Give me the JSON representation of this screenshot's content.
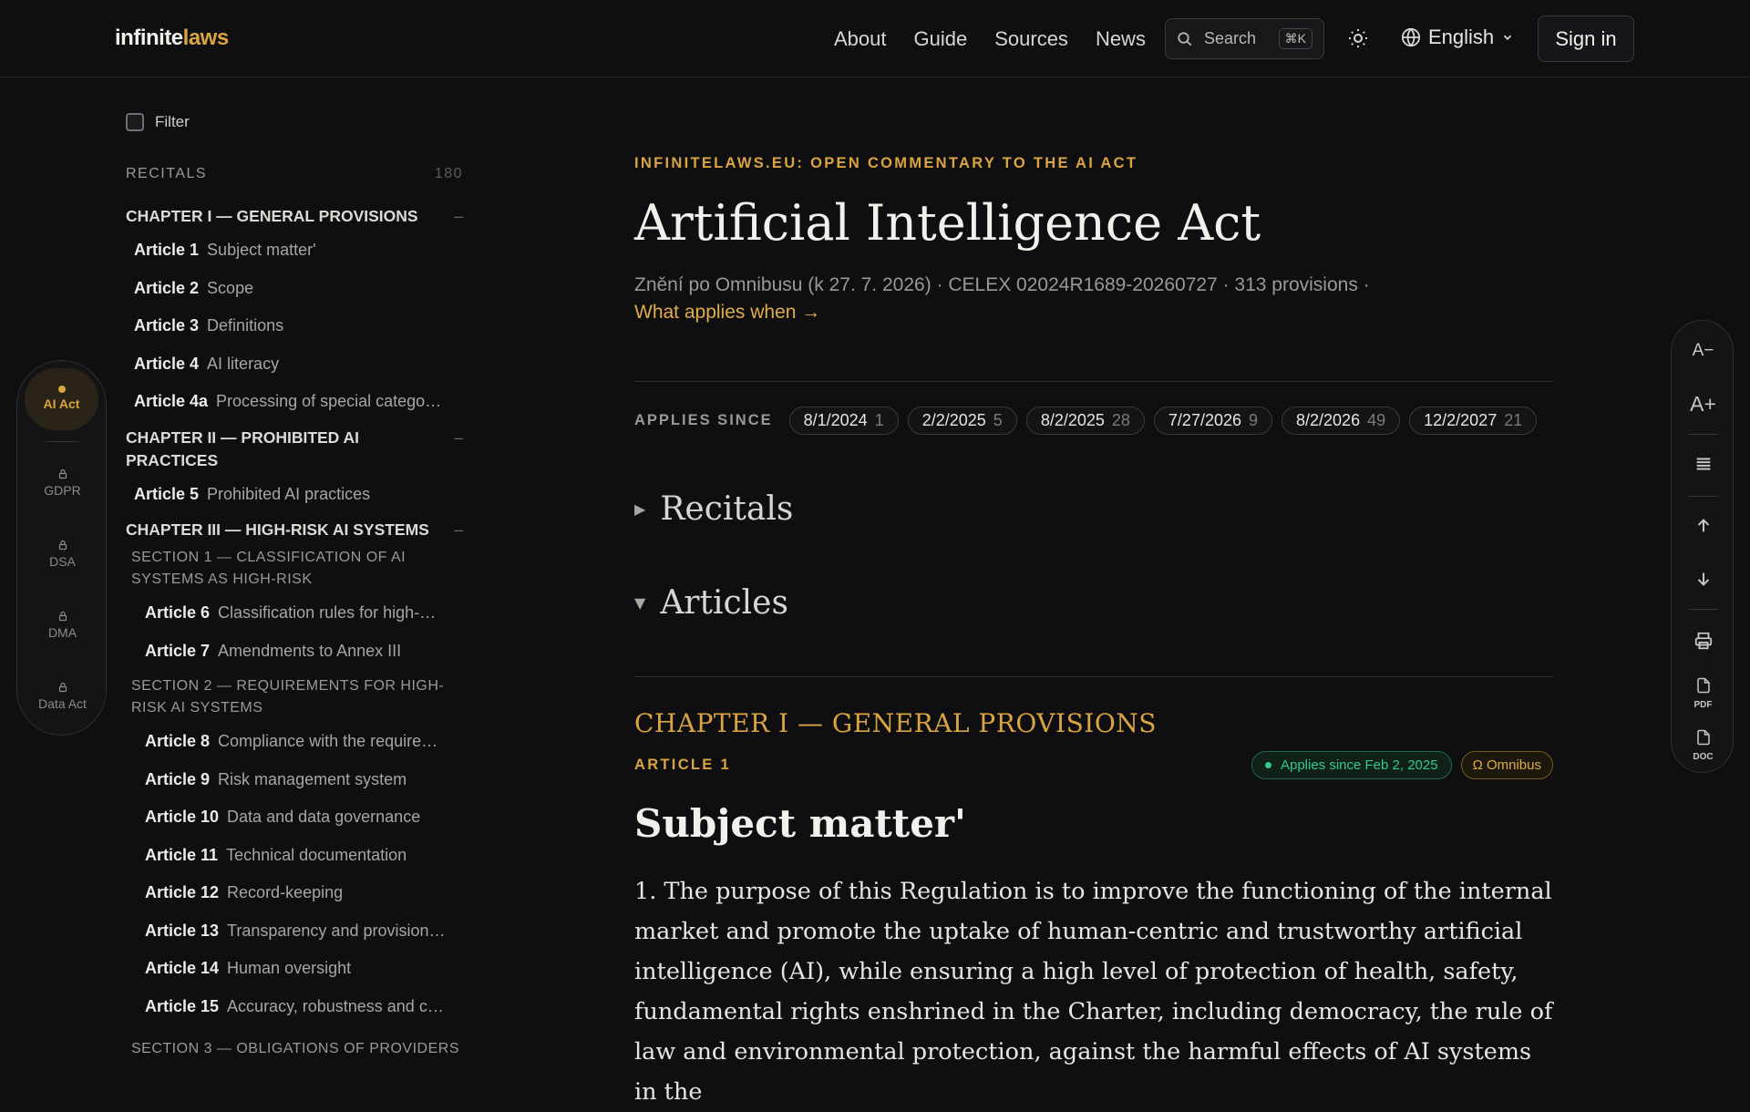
{
  "header": {
    "logo_part1": "infinite",
    "logo_part2": "laws",
    "nav": [
      "About",
      "Guide",
      "Sources",
      "News"
    ],
    "search_label": "Search",
    "search_shortcut": "⌘K",
    "language": "English",
    "signin": "Sign in"
  },
  "laws_rail": {
    "active": "AI Act",
    "items": [
      "GDPR",
      "DSA",
      "DMA",
      "Data Act"
    ]
  },
  "sidebar": {
    "filter_label": "Filter",
    "recitals_label": "RECITALS",
    "recitals_count": "180",
    "chapter1": "CHAPTER I — GENERAL PROVISIONS",
    "chapter1_articles": [
      {
        "num": "Article 1",
        "title": "Subject matter'"
      },
      {
        "num": "Article 2",
        "title": "Scope"
      },
      {
        "num": "Article 3",
        "title": "Definitions"
      },
      {
        "num": "Article 4",
        "title": "AI literacy"
      },
      {
        "num": "Article 4a",
        "title": "Processing of special catego…"
      }
    ],
    "chapter2": "CHAPTER II — PROHIBITED AI PRACTICES",
    "chapter2_articles": [
      {
        "num": "Article 5",
        "title": "Prohibited AI practices"
      }
    ],
    "chapter3": "CHAPTER III — HIGH-RISK AI SYSTEMS",
    "section1": "SECTION 1 — CLASSIFICATION OF AI SYSTEMS AS HIGH-RISK",
    "section1_articles": [
      {
        "num": "Article 6",
        "title": "Classification rules for high-…"
      },
      {
        "num": "Article 7",
        "title": "Amendments to Annex III"
      }
    ],
    "section2": "SECTION 2 — REQUIREMENTS FOR HIGH-RISK AI SYSTEMS",
    "section2_articles": [
      {
        "num": "Article 8",
        "title": "Compliance with the require…"
      },
      {
        "num": "Article 9",
        "title": "Risk management system"
      },
      {
        "num": "Article 10",
        "title": "Data and data governance"
      },
      {
        "num": "Article 11",
        "title": "Technical documentation"
      },
      {
        "num": "Article 12",
        "title": "Record-keeping"
      },
      {
        "num": "Article 13",
        "title": "Transparency and provision…"
      },
      {
        "num": "Article 14",
        "title": "Human oversight"
      },
      {
        "num": "Article 15",
        "title": "Accuracy, robustness and c…"
      }
    ],
    "section3": "SECTION 3 — OBLIGATIONS OF PROVIDERS",
    "collapse_symbol": "–"
  },
  "main": {
    "kicker": "INFINITELAWS.EU: OPEN COMMENTARY TO THE AI ACT",
    "title": "Artificial Intelligence Act",
    "meta": "Znění po Omnibusu (k 27. 7. 2026) · CELEX 02024R1689-20260727 · 313 provisions ·",
    "applies_link": "What applies when →",
    "applies_since_label": "APPLIES SINCE",
    "applies_since": [
      {
        "date": "8/1/2024",
        "count": "1"
      },
      {
        "date": "2/2/2025",
        "count": "5"
      },
      {
        "date": "8/2/2025",
        "count": "28"
      },
      {
        "date": "7/27/2026",
        "count": "9"
      },
      {
        "date": "8/2/2026",
        "count": "49"
      },
      {
        "date": "12/2/2027",
        "count": "21"
      }
    ],
    "recitals_toggle": "Recitals",
    "articles_toggle": "Articles",
    "chapter_heading": "CHAPTER I — GENERAL PROVISIONS",
    "article_label": "ARTICLE 1",
    "badge_applies": "Applies since Feb 2, 2025",
    "badge_omnibus": "Ω Omnibus",
    "article_title": "Subject matter'",
    "paragraph": "1.  The purpose of this Regulation is to improve the functioning of the internal market and promote the uptake of human-centric and trustworthy artificial intelligence (AI), while ensuring a high level of protection of health, safety, fundamental rights enshrined in the Charter, including democracy, the rule of law and environmental protection, against the harmful effects of AI systems in the"
  },
  "tools": {
    "font_decrease": "A−",
    "font_increase": "A+",
    "pdf": "PDF",
    "doc": "DOC"
  },
  "colors": {
    "accent": "#d9a441",
    "background": "#0f0f11",
    "green_badge": "#35c98a"
  }
}
